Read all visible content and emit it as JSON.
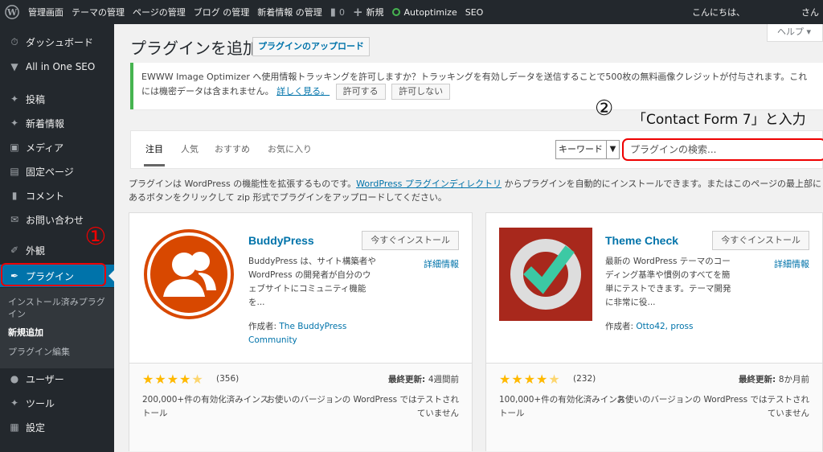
{
  "adminbar": {
    "items": [
      "管理画面",
      "テーマの管理",
      "ページの管理",
      "ブログ の管理",
      "新着情報 の管理"
    ],
    "comments_count": "0",
    "new_label": "新規",
    "autoptimize": "Autoptimize",
    "seo": "SEO",
    "greeting": "こんにちは、",
    "user": "さん"
  },
  "sidebar": {
    "items": [
      {
        "label": "ダッシュボード",
        "icon": "dashboard-icon"
      },
      {
        "label": "All in One SEO",
        "icon": "shield-icon"
      },
      {
        "label": "投稿",
        "icon": "pin-icon"
      },
      {
        "label": "新着情報",
        "icon": "pin-icon"
      },
      {
        "label": "メディア",
        "icon": "media-icon"
      },
      {
        "label": "固定ページ",
        "icon": "page-icon"
      },
      {
        "label": "コメント",
        "icon": "comment-icon"
      },
      {
        "label": "お問い合わせ",
        "icon": "mail-icon"
      },
      {
        "label": "外観",
        "icon": "brush-icon"
      },
      {
        "label": "プラグイン",
        "icon": "plugin-icon"
      },
      {
        "label": "ユーザー",
        "icon": "user-icon"
      },
      {
        "label": "ツール",
        "icon": "wrench-icon"
      },
      {
        "label": "設定",
        "icon": "settings-icon"
      }
    ],
    "submenu": [
      "インストール済みプラグイン",
      "新規追加",
      "プラグイン編集"
    ]
  },
  "annotations": {
    "step1": "①",
    "step2": "②",
    "step2_text": "「Contact Form 7」と入力"
  },
  "page": {
    "title": "プラグインを追加",
    "upload_button": "プラグインのアップロード",
    "help": "ヘルプ ▾"
  },
  "notice": {
    "text": "EWWW Image Optimizer へ使用情報トラッキングを許可しますか？トラッキングを有効しデータを送信することで500枚の無料画像クレジットが付与されます。これには機密データは含まれません。",
    "learn_more": "詳しく見る。",
    "allow": "許可する",
    "deny": "許可しない"
  },
  "tabs": [
    "注目",
    "人気",
    "おすすめ",
    "お気に入り"
  ],
  "search": {
    "type": "キーワード",
    "placeholder": "プラグインの検索..."
  },
  "intro": {
    "before": "プラグインは WordPress の機能性を拡張するものです。",
    "link": "WordPress プラグインディレクトリ",
    "after": " からプラグインを自動的にインストールできます。またはこのページの最上部にあるボタンをクリックして zip 形式でプラグインをアップロードしてください。"
  },
  "cards": [
    {
      "name": "BuddyPress",
      "install": "今すぐインストール",
      "details": "詳細情報",
      "description": "BuddyPress は、サイト構築者やWordPress の開発者が自分のウェブサイトにコミュニティ機能を...",
      "author_label": "作成者: ",
      "author": "The BuddyPress Community",
      "rating_stars": 4.5,
      "rating_count": "(356)",
      "last_updated_label": "最終更新: ",
      "last_updated": "4週間前",
      "installs": "200,000+件の有効化済みインストール",
      "compat": "お使いのバージョンの WordPress ではテストされていません",
      "logo_color": "#d84800"
    },
    {
      "name": "Theme Check",
      "install": "今すぐインストール",
      "details": "詳細情報",
      "description": "最新の WordPress テーマのコーディング基準や慣例のすべてを簡単にテストできます。テーマ開発に非常に役...",
      "author_label": "作成者: ",
      "author": "Otto42, pross",
      "rating_stars": 4.5,
      "rating_count": "(232)",
      "last_updated_label": "最終更新: ",
      "last_updated": "8か月前",
      "installs": "100,000+件の有効化済みインストール",
      "compat": "お使いのバージョンの WordPress ではテストされていません",
      "logo_color": "#a8281c"
    }
  ]
}
